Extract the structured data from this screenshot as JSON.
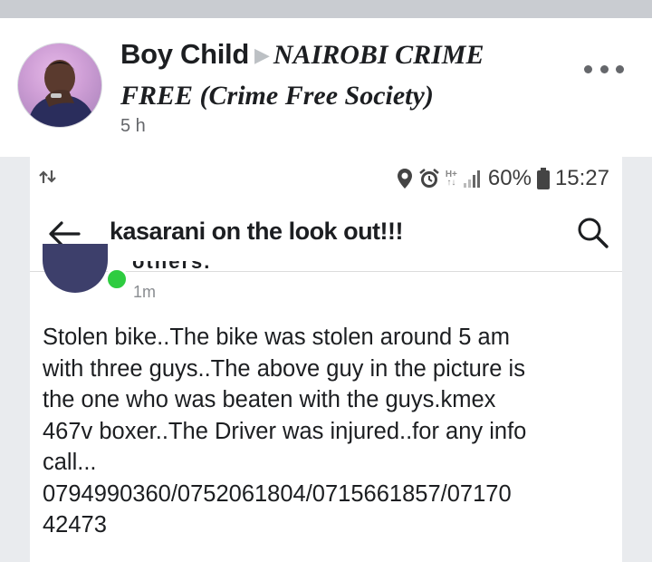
{
  "post": {
    "author": "Boy Child",
    "group_line1": "NAIROBI CRIME",
    "group_line2": "FREE (Crime Free Society)",
    "time": "5 h"
  },
  "screenshot": {
    "status": {
      "battery": "60%",
      "clock": "15:27",
      "network": "H+"
    },
    "toolbar": {
      "group_name": "kasarani on the look out!!!"
    },
    "comment": {
      "author_cut": "others.",
      "time": "1m",
      "body": "Stolen bike..The bike was stolen around 5 am\nwith three guys..The above guy in the picture is\nthe one who was beaten with the guys.kmex\n467v boxer..The Driver was injured..for any info\ncall...\n0794990360/0752061804/0715661857/07170\n42473"
    }
  },
  "colors": {
    "online_dot": "#2ecc40",
    "top_strip": "#c9ccd1",
    "secondary_text": "#65676b"
  },
  "icons": [
    "ellipsis-icon",
    "sync-arrows-icon",
    "location-pin-icon",
    "alarm-clock-icon",
    "signal-icon",
    "battery-icon",
    "back-arrow-icon",
    "search-icon"
  ]
}
